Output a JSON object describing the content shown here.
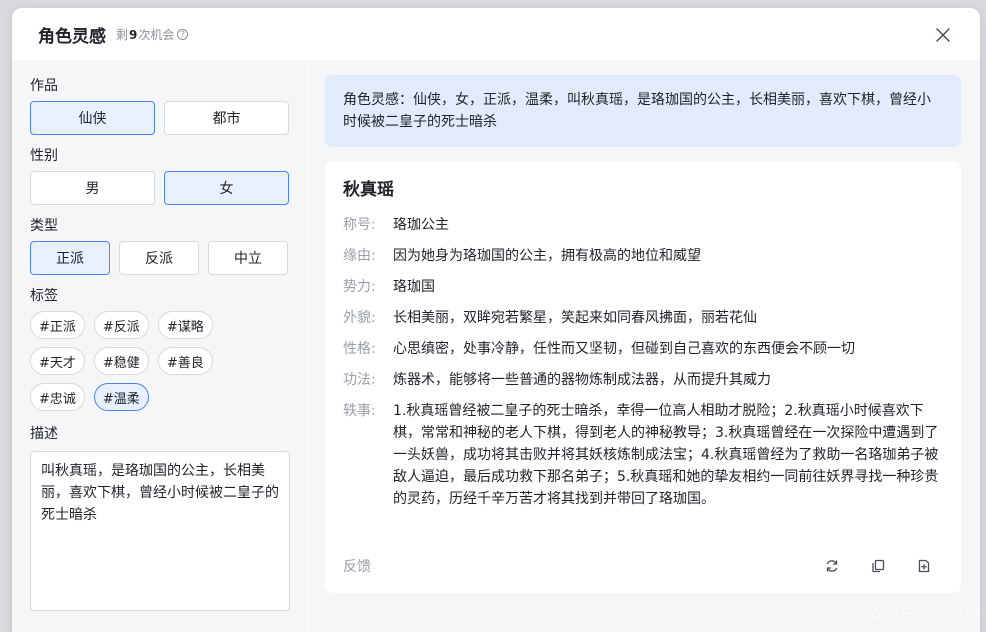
{
  "header": {
    "title": "角色灵感",
    "remain_prefix": "剩",
    "remain_count": "9",
    "remain_suffix": "次机会",
    "help_glyph": "?"
  },
  "left": {
    "work_label": "作品",
    "work_options": [
      "仙侠",
      "都市"
    ],
    "gender_label": "性别",
    "gender_options": [
      "男",
      "女"
    ],
    "type_label": "类型",
    "type_options": [
      "正派",
      "反派",
      "中立"
    ],
    "tags_label": "标签",
    "tags": [
      "#正派",
      "#反派",
      "#谋略",
      "#天才",
      "#稳健",
      "#善良",
      "#忠诚",
      "#温柔"
    ],
    "desc_label": "描述",
    "desc_value": "叫秋真瑶，是珞珈国的公主，长相美丽，喜欢下棋，曾经小时候被二皇子的死士暗杀"
  },
  "right": {
    "prompt": "角色灵感：仙侠，女，正派，温柔，叫秋真瑶，是珞珈国的公主，长相美丽，喜欢下棋，曾经小时候被二皇子的死士暗杀",
    "card": {
      "name": "秋真瑶",
      "fields": [
        {
          "k": "称号:",
          "v": "珞珈公主"
        },
        {
          "k": "缘由:",
          "v": "因为她身为珞珈国的公主，拥有极高的地位和威望"
        },
        {
          "k": "势力:",
          "v": "珞珈国"
        },
        {
          "k": "外貌:",
          "v": "长相美丽，双眸宛若繁星，笑起来如同春风拂面，丽若花仙"
        },
        {
          "k": "性格:",
          "v": "心思缜密，处事冷静，任性而又坚韧，但碰到自己喜欢的东西便会不顾一切"
        },
        {
          "k": "功法:",
          "v": "炼器术，能够将一些普通的器物炼制成法器，从而提升其威力"
        },
        {
          "k": "轶事:",
          "v": "1.秋真瑶曾经被二皇子的死士暗杀，幸得一位高人相助才脱险；2.秋真瑶小时候喜欢下棋，常常和神秘的老人下棋，得到老人的神秘教导；3.秋真瑶曾经在一次探险中遭遇到了一头妖兽，成功将其击败并将其妖核炼制成法宝；4.秋真瑶曾经为了救助一名珞珈弟子被敌人逼迫，最后成功救下那名弟子；5.秋真瑶和她的挚友相约一同前往妖界寻找一种珍贵的灵药，历经千辛万苦才将其找到并带回了珞珈国。"
        }
      ],
      "feedback": "反馈"
    }
  },
  "watermark": "FSGAMEO.COM",
  "colors": {
    "accent": "#4f84f0",
    "selected_bg": "#e8effd",
    "prompt_bg": "#e2ebfb"
  }
}
